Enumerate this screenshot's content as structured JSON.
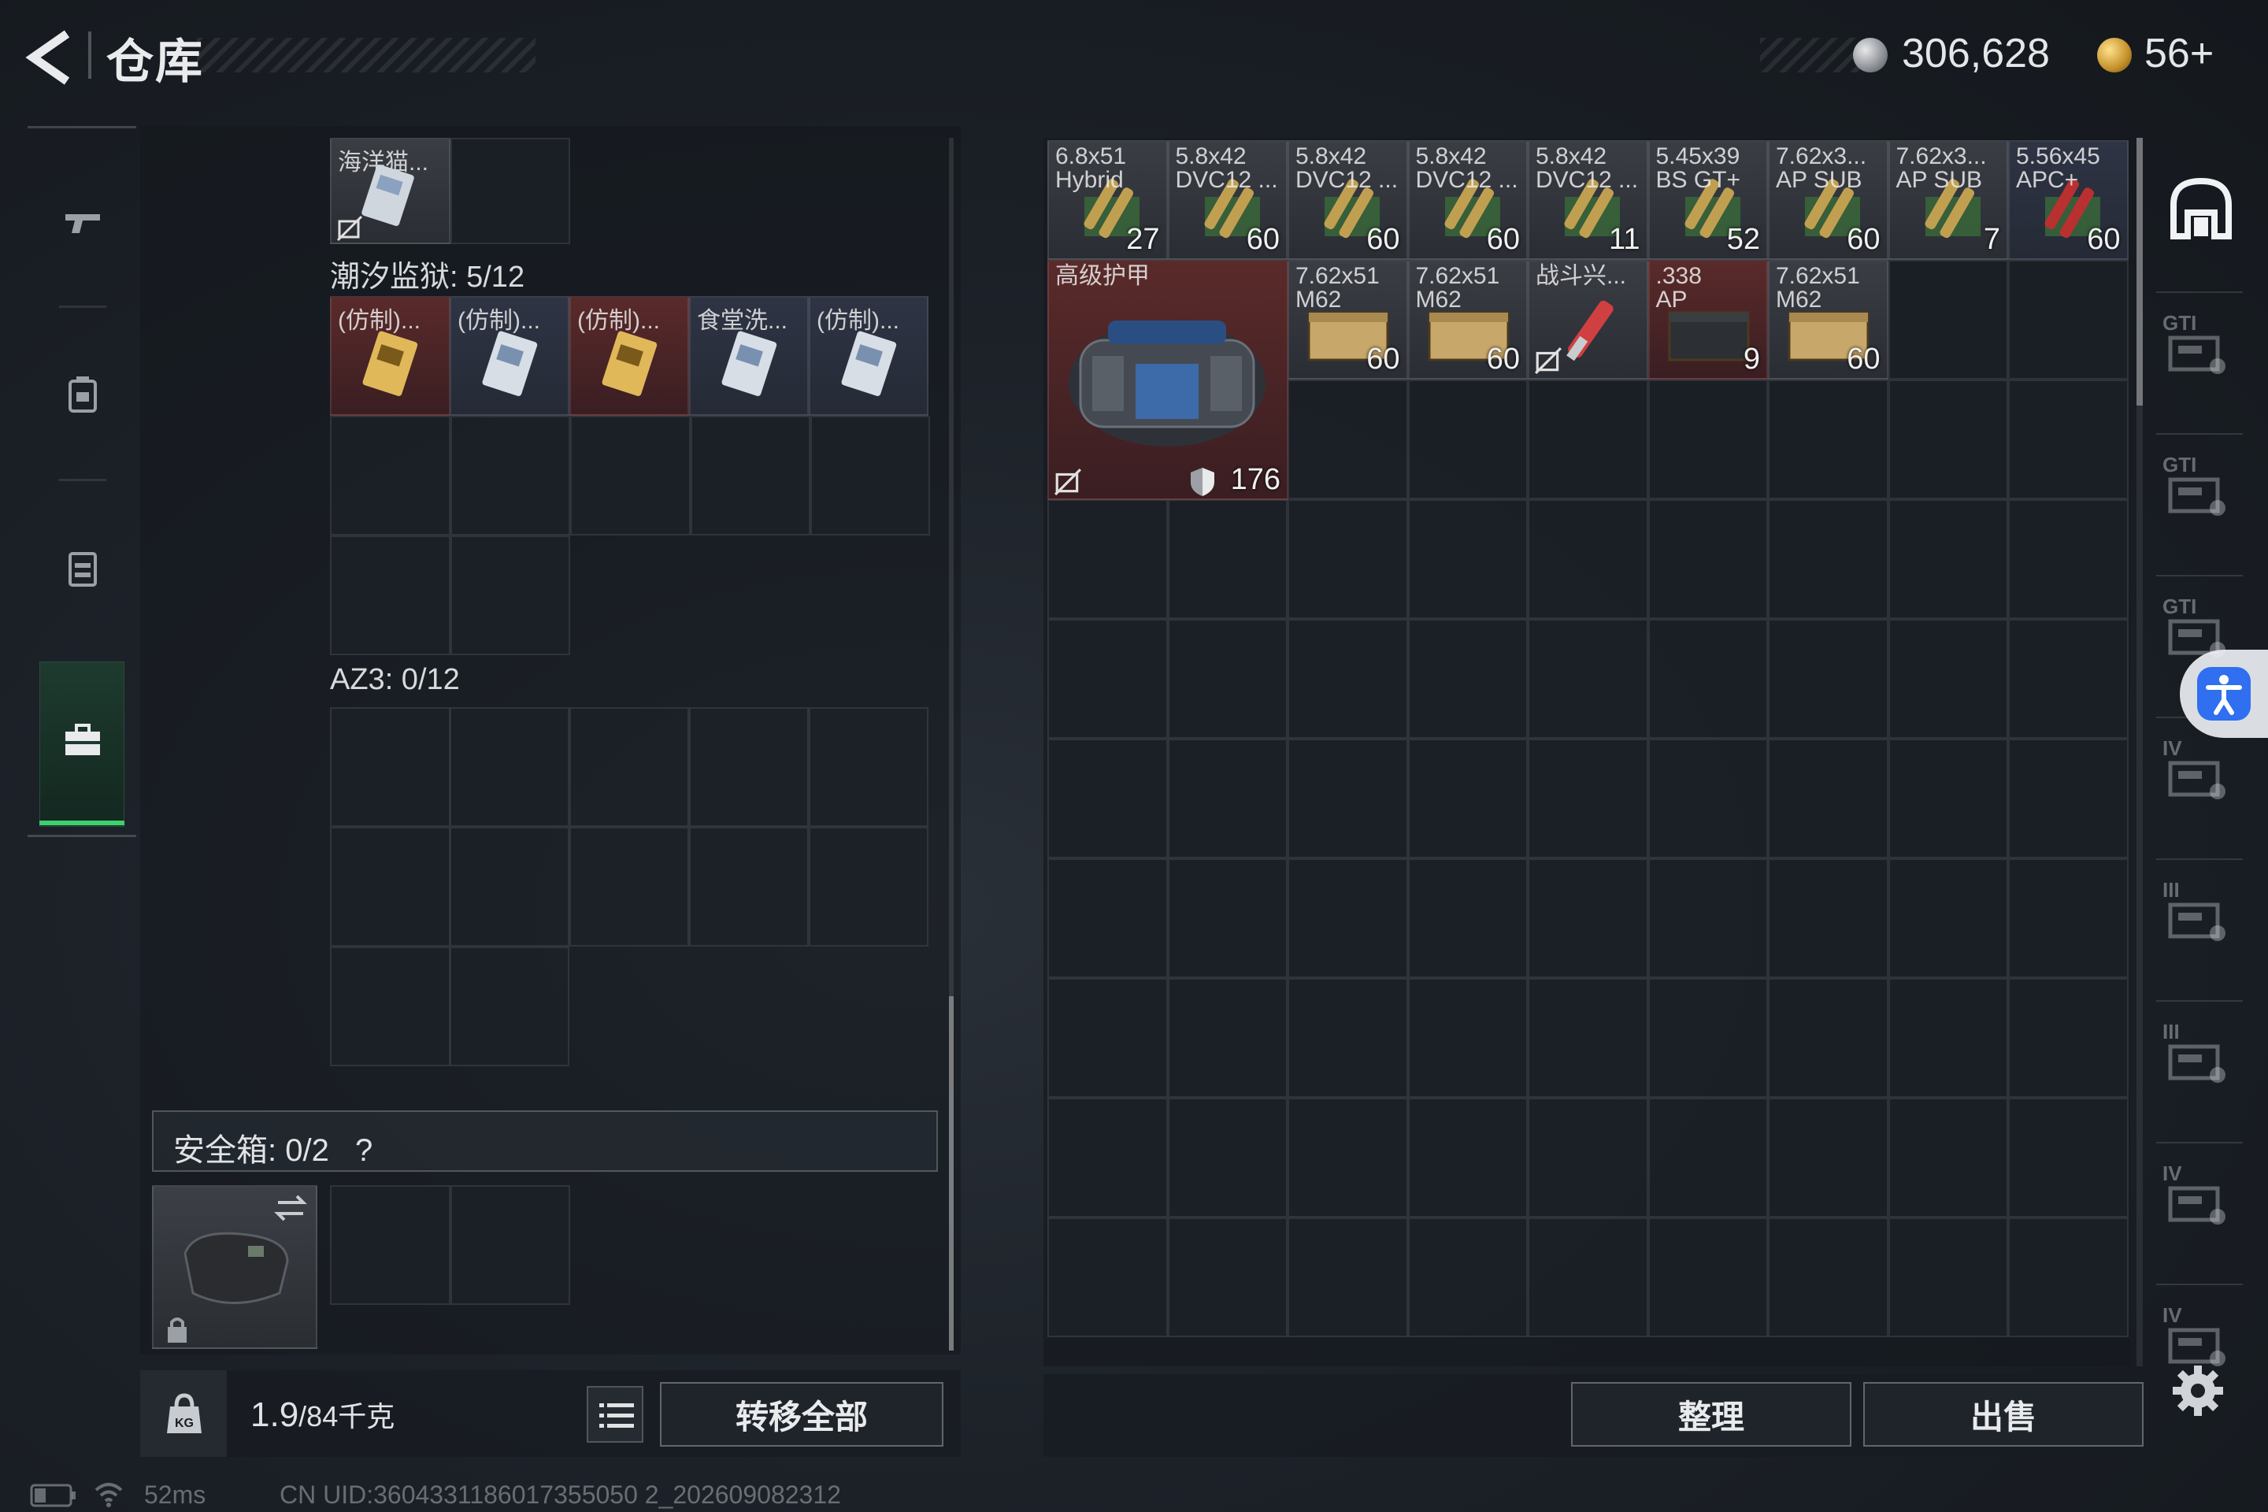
{
  "header": {
    "title": "仓库",
    "silver_amount": "306,628",
    "gold_amount": "56+"
  },
  "left": {
    "top_item": {
      "label": "海洋猫..."
    },
    "section1": {
      "title": "潮汐监狱: 5/12",
      "items": [
        {
          "label": "(仿制)...",
          "color": "red"
        },
        {
          "label": "(仿制)...",
          "color": "blue"
        },
        {
          "label": "(仿制)...",
          "color": "red"
        },
        {
          "label": "食堂洗...",
          "color": "blue"
        },
        {
          "label": "(仿制)...",
          "color": "blue"
        }
      ]
    },
    "section2": {
      "title": "AZ3: 0/12"
    },
    "safe": {
      "title": "安全箱: 0/2",
      "help": "?"
    },
    "bottom": {
      "weight_current": "1.9",
      "weight_max": "/84千克",
      "transfer_all": "转移全部"
    }
  },
  "stash": {
    "row1": [
      {
        "label": "6.8x51\nHybrid",
        "count": "27",
        "color": "gray"
      },
      {
        "label": "5.8x42\nDVC12 ...",
        "count": "60",
        "color": "gray"
      },
      {
        "label": "5.8x42\nDVC12 ...",
        "count": "60",
        "color": "gray"
      },
      {
        "label": "5.8x42\nDVC12 ...",
        "count": "60",
        "color": "gray"
      },
      {
        "label": "5.8x42\nDVC12 ...",
        "count": "11",
        "color": "gray"
      },
      {
        "label": "5.45x39\nBS GT+",
        "count": "52",
        "color": "gray"
      },
      {
        "label": "7.62x3...\nAP SUB",
        "count": "60",
        "color": "gray"
      },
      {
        "label": "7.62x3...\nAP SUB",
        "count": "7",
        "color": "gray"
      },
      {
        "label": "5.56x45\nAPC+",
        "count": "60",
        "color": "blue"
      }
    ],
    "armor": {
      "label": "高级护甲",
      "durability": "176"
    },
    "row2": [
      {
        "label": "7.62x51\nM62",
        "count": "60",
        "color": "gray"
      },
      {
        "label": "7.62x51\nM62",
        "count": "60",
        "color": "gray"
      },
      {
        "label": "战斗兴...",
        "count": "",
        "color": "gray"
      },
      {
        "label": ".338\nAP",
        "count": "9",
        "color": "red"
      },
      {
        "label": "7.62x51\nM62",
        "count": "60",
        "color": "gray"
      }
    ],
    "sort": "整理",
    "sell": "出售"
  },
  "rail_labels": [
    "GTI",
    "GTI",
    "GTI",
    "IV",
    "III",
    "III",
    "IV",
    "IV"
  ],
  "status": {
    "ping": "52ms",
    "uid": "CN UID:3604331186017355050 2_202609082312"
  },
  "colors": {
    "accent_green": "#3ecf6e",
    "item_red": "#5a2a2a",
    "item_blue": "#2e3444"
  }
}
